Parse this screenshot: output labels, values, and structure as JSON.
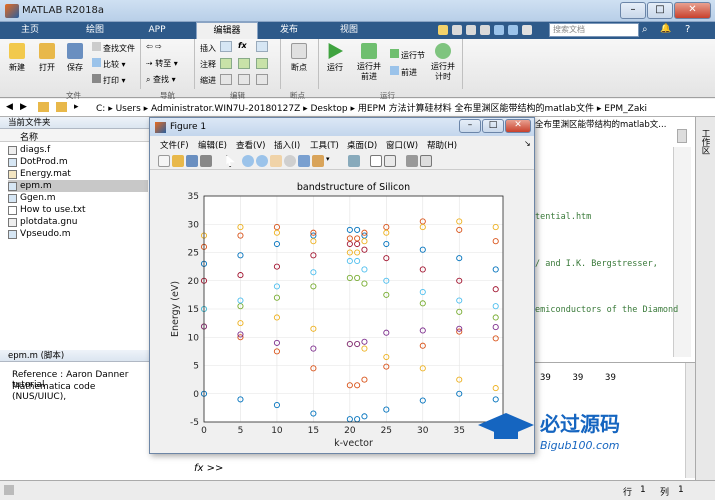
{
  "window": {
    "title": "MATLAB R2018a",
    "minimize": "–",
    "restore": "□",
    "close": "✕"
  },
  "tabs": [
    "主页",
    "绘图",
    "APP",
    "编辑器",
    "发布",
    "视图"
  ],
  "active_tab": "编辑器",
  "search_placeholder": "搜索文档",
  "ribbon": {
    "file": {
      "new": "新建",
      "open": "打开",
      "save": "保存",
      "find_files": "查找文件",
      "compare": "比较",
      "print": "打印",
      "group": "文件"
    },
    "nav": {
      "goto": "转至",
      "find": "查找",
      "group": "导航"
    },
    "edit": {
      "insert": "插入",
      "comment": "注释",
      "indent": "缩进",
      "fx": "fx",
      "group": "编辑"
    },
    "breakpoints": {
      "label": "断点",
      "group": "断点"
    },
    "run": {
      "run": "运行",
      "run_advance": "运行并\n前进",
      "run_section": "运行节",
      "advance": "前进",
      "run_time": "运行并\n计时",
      "group": "运行"
    }
  },
  "address": {
    "path": [
      "C:",
      "Users",
      "Administrator.WIN7U-20180127Z",
      "Desktop",
      "用EPM 方法计算硅材料 全布里渊区能带结构的matlab文件",
      "EPM_Zaki"
    ]
  },
  "file_panel": {
    "title": "当前文件夹",
    "col_name": "名称",
    "files": [
      {
        "name": "diags.f",
        "icon": "file-icon"
      },
      {
        "name": "DotProd.m",
        "icon": "m-file-icon"
      },
      {
        "name": "Energy.mat",
        "icon": "mat-file-icon"
      },
      {
        "name": "epm.m",
        "icon": "m-file-icon",
        "selected": true
      },
      {
        "name": "Ggen.m",
        "icon": "m-file-icon"
      },
      {
        "name": "How to use.txt",
        "icon": "text-file-icon"
      },
      {
        "name": "plotdata.gnu",
        "icon": "file-icon"
      },
      {
        "name": "Vpseudo.m",
        "icon": "m-file-icon"
      }
    ]
  },
  "detail_panel": {
    "title": "epm.m  (脚本)",
    "line1": "Reference : Aaron Danner tutorial",
    "line2": "Mathematica code (NUS/UIUC),"
  },
  "editor": {
    "header": "全布里渊区能带结构的matlab文...",
    "code": [
      "tential.htm",
      "/ and I.K. Bergstresser,",
      "emiconductors of the Diamond"
    ]
  },
  "command_window": {
    "prompt": "fx >>",
    "numbers": "39    39    39"
  },
  "right_strip": {
    "label": "工作区"
  },
  "status": {
    "row_label": "行",
    "row": "1",
    "col_label": "列",
    "col": "1"
  },
  "figure": {
    "title": "Figure 1",
    "menu": [
      "文件(F)",
      "编辑(E)",
      "查看(V)",
      "插入(I)",
      "工具(T)",
      "桌面(D)",
      "窗口(W)",
      "帮助(H)"
    ]
  },
  "chart_data": {
    "type": "scatter",
    "title": "bandstructure of Silicon",
    "xlabel": "k-vector",
    "ylabel": "Energy (eV)",
    "xlim": [
      0,
      41
    ],
    "ylim": [
      -5,
      35
    ],
    "xticks": [
      0,
      5,
      10,
      15,
      20,
      25,
      30,
      35
    ],
    "yticks": [
      -5,
      0,
      5,
      10,
      15,
      20,
      25,
      30,
      35
    ],
    "marker": "open-circle",
    "colors": [
      "#0072bd",
      "#d95319",
      "#edb120",
      "#7e2f8e",
      "#77ac30",
      "#4dbeee",
      "#a2142f"
    ],
    "series": [
      {
        "color": "#0072bd",
        "x": [
          0,
          5,
          10,
          15,
          20,
          21,
          22,
          25,
          30,
          35,
          40
        ],
        "y": [
          0.0,
          -1.0,
          -2.0,
          -3.5,
          -4.5,
          -4.5,
          -4.0,
          -2.8,
          -1.2,
          0.0,
          -1.0
        ]
      },
      {
        "color": "#d95319",
        "x": [
          0,
          5,
          10,
          15,
          20,
          21,
          22,
          25,
          30,
          35,
          40
        ],
        "y": [
          11.9,
          10.0,
          7.5,
          4.5,
          1.5,
          1.5,
          2.5,
          4.8,
          8.5,
          11.0,
          9.8
        ]
      },
      {
        "color": "#edb120",
        "x": [
          0,
          5,
          10,
          15,
          20,
          21,
          22,
          25,
          30,
          35,
          40
        ],
        "y": [
          11.9,
          12.5,
          13.5,
          11.5,
          8.8,
          8.8,
          8.0,
          6.5,
          4.5,
          2.5,
          1.0
        ]
      },
      {
        "color": "#7e2f8e",
        "x": [
          0,
          5,
          10,
          15,
          20,
          21,
          22,
          25,
          30,
          35,
          40
        ],
        "y": [
          11.9,
          10.5,
          9.0,
          8.0,
          8.8,
          8.8,
          9.2,
          10.8,
          11.2,
          11.5,
          11.8
        ]
      },
      {
        "color": "#77ac30",
        "x": [
          0,
          5,
          10,
          15,
          20,
          21,
          22,
          25,
          30,
          35,
          40
        ],
        "y": [
          15.0,
          15.5,
          17.0,
          19.0,
          20.5,
          20.5,
          19.5,
          17.5,
          16.0,
          14.5,
          13.5
        ]
      },
      {
        "color": "#4dbeee",
        "x": [
          0,
          5,
          10,
          15,
          20,
          21,
          22,
          25,
          30,
          35,
          40
        ],
        "y": [
          15.0,
          16.5,
          19.0,
          21.5,
          23.5,
          23.5,
          22.0,
          20.0,
          18.0,
          16.5,
          15.5
        ]
      },
      {
        "color": "#a2142f",
        "x": [
          0,
          5,
          10,
          15,
          20,
          21,
          22,
          25,
          30,
          35,
          40
        ],
        "y": [
          20.0,
          21.0,
          22.5,
          24.5,
          26.5,
          26.5,
          25.5,
          24.0,
          22.0,
          20.0,
          18.5
        ]
      },
      {
        "color": "#0072bd",
        "x": [
          0,
          5,
          10,
          15,
          20,
          21,
          22,
          25,
          30,
          35,
          40
        ],
        "y": [
          23.0,
          24.5,
          26.5,
          28.0,
          29.0,
          29.0,
          28.0,
          26.5,
          25.5,
          24.0,
          22.0
        ]
      },
      {
        "color": "#d95319",
        "x": [
          0,
          5,
          10,
          15,
          20,
          21,
          22,
          25,
          30,
          35,
          40
        ],
        "y": [
          26.0,
          28.0,
          29.5,
          28.5,
          27.5,
          27.5,
          28.5,
          29.5,
          30.5,
          29.0,
          27.0
        ]
      },
      {
        "color": "#edb120",
        "x": [
          0,
          5,
          10,
          15,
          20,
          21,
          22,
          25,
          30,
          35,
          40
        ],
        "y": [
          28.0,
          29.5,
          28.5,
          27.0,
          25.0,
          25.0,
          27.0,
          28.5,
          29.5,
          30.5,
          29.5
        ]
      }
    ]
  }
}
